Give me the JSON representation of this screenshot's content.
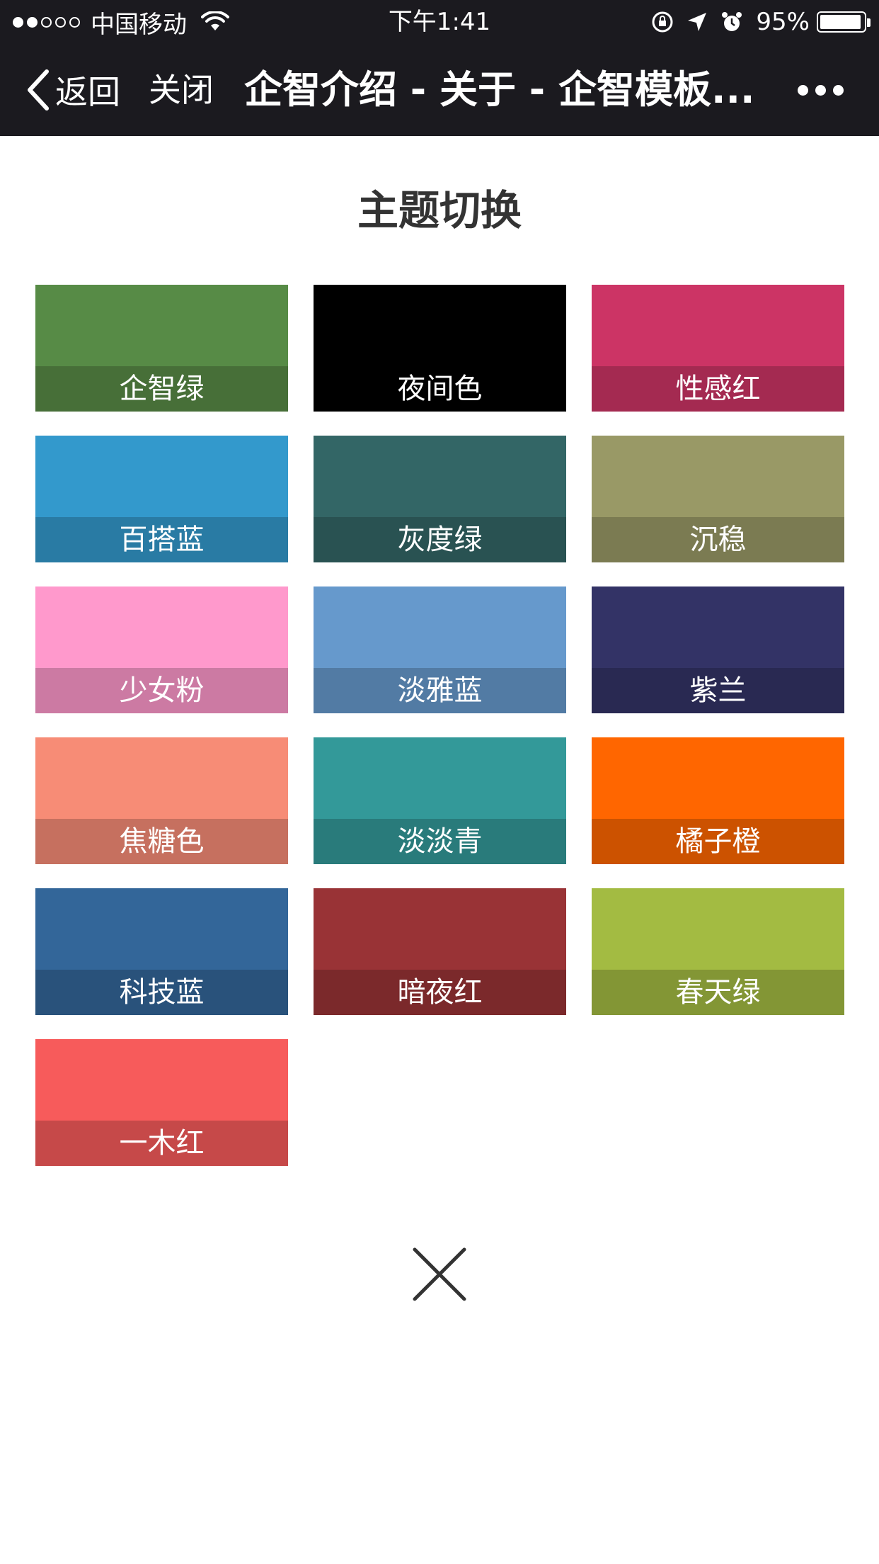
{
  "status_bar": {
    "carrier": "中国移动",
    "time": "下午1:41",
    "battery": "95%",
    "battery_level": 0.95,
    "signal_strength_of_5": 2
  },
  "nav": {
    "back_label": "返回",
    "close_label": "关闭",
    "title": "企智介绍 - 关于 - 企智模板..."
  },
  "sheet": {
    "title": "主题切换"
  },
  "themes": [
    {
      "label": "企智绿",
      "color": "#578b46",
      "label_bg": "#476f38"
    },
    {
      "label": "夜间色",
      "color": "#000000",
      "label_bg": "#000000"
    },
    {
      "label": "性感红",
      "color": "#cc3465",
      "label_bg": "#a42a51"
    },
    {
      "label": "百搭蓝",
      "color": "#3399cc",
      "label_bg": "#297ba4"
    },
    {
      "label": "灰度绿",
      "color": "#336666",
      "label_bg": "#295252"
    },
    {
      "label": "沉稳",
      "color": "#999966",
      "label_bg": "#7b7b52"
    },
    {
      "label": "少女粉",
      "color": "#ff99cc",
      "label_bg": "#cc7aa3"
    },
    {
      "label": "淡雅蓝",
      "color": "#6699cc",
      "label_bg": "#527ba4"
    },
    {
      "label": "紫兰",
      "color": "#333366",
      "label_bg": "#292952"
    },
    {
      "label": "焦糖色",
      "color": "#f78c76",
      "label_bg": "#c6705f"
    },
    {
      "label": "淡淡青",
      "color": "#339999",
      "label_bg": "#297b7b"
    },
    {
      "label": "橘子橙",
      "color": "#ff6600",
      "label_bg": "#cc5200"
    },
    {
      "label": "科技蓝",
      "color": "#336699",
      "label_bg": "#29527b"
    },
    {
      "label": "暗夜红",
      "color": "#993336",
      "label_bg": "#7b292b"
    },
    {
      "label": "春天绿",
      "color": "#a3bb42",
      "label_bg": "#839635"
    },
    {
      "label": "一木红",
      "color": "#f75b5b",
      "label_bg": "#c64949"
    }
  ],
  "icons": {
    "back": "chevron-left-icon",
    "more": "more-dots-icon",
    "close": "close-icon",
    "wifi": "wifi-icon",
    "lock_rotation": "rotation-lock-icon",
    "location": "location-arrow-icon",
    "alarm": "alarm-icon"
  }
}
